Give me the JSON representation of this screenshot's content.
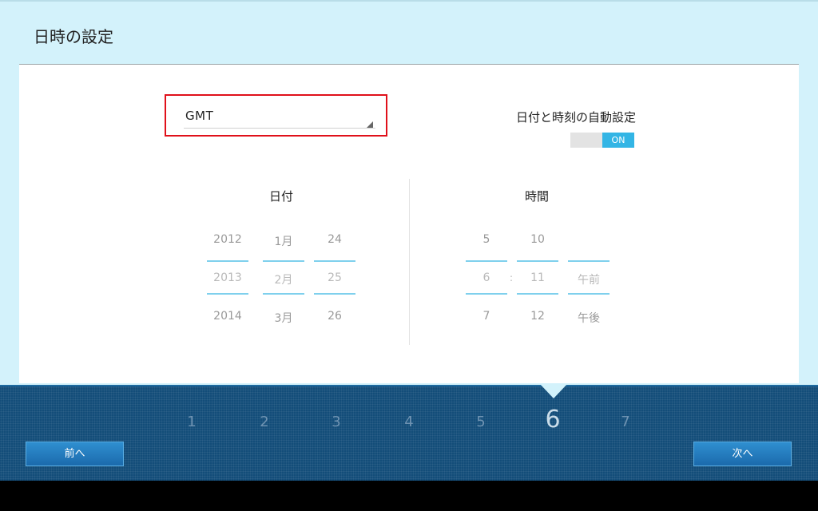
{
  "header": {
    "title": "日時の設定"
  },
  "timezone": {
    "value": "GMT"
  },
  "auto": {
    "label": "日付と時刻の自動設定",
    "toggle": "ON"
  },
  "date": {
    "title": "日付",
    "years": [
      "2012",
      "2013",
      "2014"
    ],
    "months": [
      "1月",
      "2月",
      "3月"
    ],
    "days": [
      "24",
      "25",
      "26"
    ]
  },
  "time": {
    "title": "時間",
    "hours": [
      "5",
      "6",
      "7"
    ],
    "minutes": [
      "10",
      "11",
      "12"
    ],
    "ampm": [
      "午前",
      "午後"
    ],
    "separator": ":"
  },
  "steps": [
    "1",
    "2",
    "3",
    "4",
    "5",
    "6",
    "7"
  ],
  "current_step": "6",
  "nav": {
    "prev": "前へ",
    "next": "次へ"
  },
  "colors": {
    "accent": "#33b5e5",
    "highlight_box": "#e0101a",
    "footer": "#134d79"
  }
}
